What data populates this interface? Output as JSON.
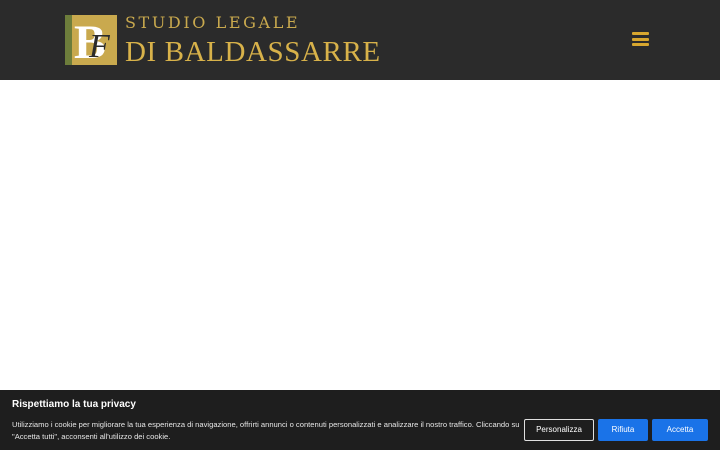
{
  "header": {
    "logo_line1": "STUDIO LEGALE",
    "logo_line2": "DI BALDASSARRE",
    "logo_mark_letters": "BF",
    "menu_icon": "hamburger-menu-icon"
  },
  "cookie_banner": {
    "title": "Rispettiamo la tua privacy",
    "text": "Utilizziamo i cookie per migliorare la tua esperienza di navigazione, offrirti annunci o contenuti personalizzati e analizzare il nostro traffico. Cliccando su \"Accetta tutti\", acconsenti all'utilizzo dei cookie.",
    "customize_label": "Personalizza",
    "reject_label": "Rifiuta",
    "accept_label": "Accetta"
  },
  "colors": {
    "header_bg": "#2b2b2b",
    "gold": "#d8b24a",
    "banner_bg": "#1e1e1e",
    "button_blue": "#1a73e8"
  }
}
